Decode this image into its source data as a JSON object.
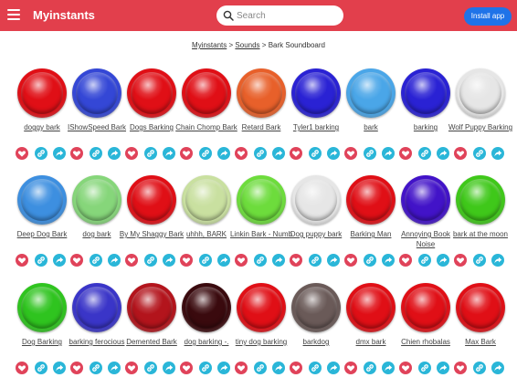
{
  "header": {
    "brand": "Myinstants",
    "search_placeholder": "Search",
    "install_label": "Install app",
    "bg_color": "#e23f4c"
  },
  "breadcrumb": {
    "home": "Myinstants",
    "sep1": ">",
    "sounds": "Sounds",
    "sep2": ">",
    "current": "Bark Soundboard"
  },
  "sounds": [
    {
      "label": "doggy bark",
      "color": "#e00f16"
    },
    {
      "label": "IShowSpeed Bark",
      "color": "#3447d6"
    },
    {
      "label": "Dogs Barking",
      "color": "#e00f16"
    },
    {
      "label": "Chain Chomp Bark",
      "color": "#e00f16"
    },
    {
      "label": "Retard Bark",
      "color": "#e8602a"
    },
    {
      "label": "Tyler1 barking",
      "color": "#2a22d4"
    },
    {
      "label": "bark",
      "color": "#4aa6e8"
    },
    {
      "label": "barking",
      "color": "#2a22d4"
    },
    {
      "label": "Wolf Puppy Barking",
      "color": "#e6e6e6"
    },
    {
      "label": "Deep Dog Bark",
      "color": "#3d8fe0"
    },
    {
      "label": "dog bark",
      "color": "#86d67a"
    },
    {
      "label": "By My Shaggy Bark",
      "color": "#e00f16"
    },
    {
      "label": "uhhh, BARK",
      "color": "#c9e0a0"
    },
    {
      "label": "Linkin Bark - Numb",
      "color": "#6ddc3c"
    },
    {
      "label": "Dog puppy bark",
      "color": "#e6e6e6"
    },
    {
      "label": "Barking Man",
      "color": "#e00f16"
    },
    {
      "label": "Annoying Book Noise",
      "color": "#4213c8"
    },
    {
      "label": "bark at the moon",
      "color": "#3fc81a"
    },
    {
      "label": "Dog Barking",
      "color": "#2fc41f"
    },
    {
      "label": "barking ferocious",
      "color": "#3a35c8"
    },
    {
      "label": "Demented Bark",
      "color": "#b3141c"
    },
    {
      "label": "dog barking -.",
      "color": "#3a0a0e"
    },
    {
      "label": "tiny dog barking",
      "color": "#e00f16"
    },
    {
      "label": "barkdog",
      "color": "#6a5a58"
    },
    {
      "label": "dmx bark",
      "color": "#e00f16"
    },
    {
      "label": "Chien rhobalas",
      "color": "#e00f16"
    },
    {
      "label": "Max Bark",
      "color": "#e00f16"
    }
  ],
  "icons": {
    "favorite": "heart-icon",
    "copy_link": "link-icon",
    "share": "share-icon",
    "menu": "hamburger-icon",
    "search": "search-icon"
  },
  "colors": {
    "favorite_bg": "#e0435a",
    "action_bg": "#2ab6d8",
    "install_bg": "#1f73e8"
  }
}
